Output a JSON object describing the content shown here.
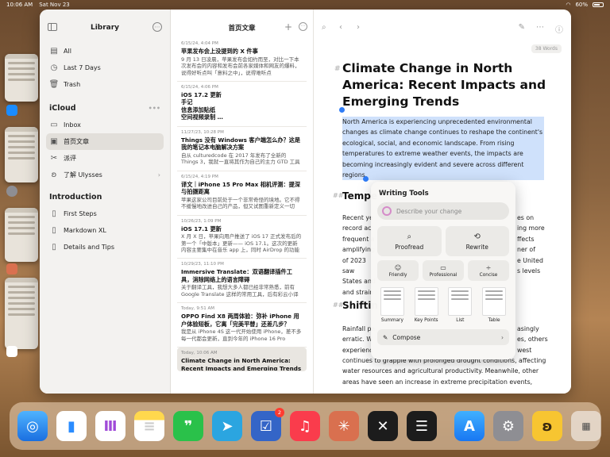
{
  "status": {
    "time": "10:06 AM",
    "date": "Sat Nov 23",
    "battery": "60%"
  },
  "sidebar": {
    "title": "Library",
    "items": [
      {
        "label": "All"
      },
      {
        "label": "Last 7 Days"
      },
      {
        "label": "Trash"
      }
    ],
    "icloud": {
      "title": "iCloud",
      "items": [
        {
          "label": "Inbox"
        },
        {
          "label": "首页文章"
        },
        {
          "label": "派评"
        },
        {
          "label": "了解 Ulysses"
        }
      ]
    },
    "intro": {
      "title": "Introduction",
      "items": [
        {
          "label": "First Steps"
        },
        {
          "label": "Markdown XL"
        },
        {
          "label": "Details and Tips"
        }
      ]
    }
  },
  "sheets": {
    "title": "首页文章",
    "items": [
      {
        "date": "6/15/24, 4:04 PM",
        "title": "苹果发布会上没提到的 X 件事",
        "excerpt": "9 月 13 日凌晨，苹果发布会如约而至，对比一下本次发布会的内容和发布会前各家媒体和网友的爆料，说得好听点叫「意料之中」，说得难听点"
      },
      {
        "date": "6/15/24, 4:06 PM",
        "title": "iOS 17.2 更新\n手记\n信息添加贴纸\n空间视频录制 …",
        "excerpt": ""
      },
      {
        "date": "11/27/23, 10:28 PM",
        "title": "Things 没有 Windows 客户端怎么办？这是我的笔记本电脑解决方案",
        "excerpt": "自从 culturedcode 在 2017 年发布了全新的 Things 3，我就一直将其作为自己的主力 GTD 工具使用"
      },
      {
        "date": "6/15/24, 4:19 PM",
        "title": "译文｜iPhone 15 Pro Max 相机评测：提深与拍摄距离",
        "excerpt": "苹果这家公司目前处于一个非常奇怪的境地。它不得不缓慢地改进自己的产品，但又试图重新定义一切"
      },
      {
        "date": "10/26/23, 1:09 PM",
        "title": "iOS 17.1 更新",
        "excerpt": "X 月 X 日，苹果向用户推送了 iOS 17 正式发布后的第一个「中版本」更新—— iOS 17.1。这次的更新内容主要集中在音乐 app 上，同时 AirDrop 的功能"
      },
      {
        "date": "10/29/23, 11:10 PM",
        "title": "Immersive Translate：双语翻译插件工具，消除网络上的语言障碍",
        "excerpt": "关于翻译工具，我想大多人都已经非常熟悉，前有 Google Translate 这样的常用工具，后有彩云小译"
      },
      {
        "date": "Today, 9:51 AM",
        "title": "OPPO Find X8 两周体验：弥补 iPhone 用户体验短板，它离「完美平替」还差几步？",
        "excerpt": "我是从 iPhone 4S 这一代开始使用 iPhone，差不多每一代都会更新，直到今年的 iPhone 16 Pro"
      },
      {
        "date": "Today, 10:06 AM",
        "title": "Climate Change in North America: Recent Impacts and Emerging Trends",
        "excerpt": ""
      }
    ]
  },
  "editor": {
    "word_count": "38 Words",
    "title": "Climate Change in North America: Recent Impacts and Emerging Trends",
    "selected_paragraph": "North America is experiencing unprecedented environmental changes as climate change continues to reshape the continent's ecological, social, and economic landscape. From rising temperatures to extreme weather events, the impacts are becoming increasingly evident and severe across different regions.",
    "h2a": "Tempe",
    "para2_lines": [
      "Recent ye",
      "record ac",
      "frequent a",
      "amplifying",
      "of 2023 saw",
      "States and",
      "and strain"
    ],
    "para2_right": [
      "es on",
      "ing more",
      "ffects",
      "ner of",
      "e United",
      "s levels",
      ""
    ],
    "h2b": "Shiftin",
    "para3_lines": [
      "Rainfall pa",
      "erratic. W",
      "experienc"
    ],
    "para3_right": [
      "asingly",
      "es, others",
      "west"
    ],
    "para3_full": [
      "continues to grapple with prolonged drought conditions, affecting",
      "water resources and agricultural productivity. Meanwhile, other",
      "areas have seen an increase in extreme precipitation events,"
    ]
  },
  "writing_tools": {
    "title": "Writing Tools",
    "placeholder": "Describe your change",
    "proofread": "Proofread",
    "rewrite": "Rewrite",
    "friendly": "Friendly",
    "professional": "Professional",
    "concise": "Concise",
    "summary": "Summary",
    "key_points": "Key Points",
    "list": "List",
    "table": "Table",
    "compose": "Compose"
  },
  "dock": {
    "badge_count": "2",
    "apps": [
      "safari",
      "ulysses",
      "podcasts",
      "notes",
      "wechat",
      "telegram",
      "omnifocus",
      "music",
      "claude",
      "perplexity",
      "reeder",
      "app-store",
      "settings",
      "tes",
      "app-library"
    ]
  }
}
